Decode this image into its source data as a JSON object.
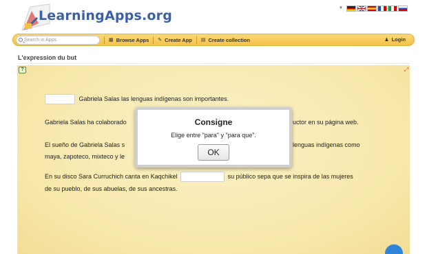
{
  "header": {
    "logo_text": "LearningApps.org",
    "languages": [
      "de",
      "en",
      "es",
      "fr",
      "it",
      "ru"
    ]
  },
  "nav": {
    "search_placeholder": "Search in Apps",
    "items": [
      {
        "label": "Browse Apps",
        "icon": "grid-icon"
      },
      {
        "label": "Create App",
        "icon": "pencil-icon"
      },
      {
        "label": "Create collection",
        "icon": "collection-icon"
      }
    ],
    "login_label": "Login"
  },
  "page": {
    "title": "L'expression du but"
  },
  "exercise": {
    "line1_text": "Gabriela Salas las lenguas indígenas son importantes.",
    "line2_left": "Gabriela Salas ha colaborado",
    "line2_right": "uctor en su página web.",
    "line3_left": "El sueño de Gabriela Salas s",
    "line3_right": "lenguas indígenas como",
    "line4_left": "maya, zapoteco, mixteco y le",
    "line5_left": "En su disco Sara Curruchich canta en Kaqchikel",
    "line5_right": "su público sepa que se inspira de las mujeres",
    "line6_text": "de su pueblo, de sus abuelas, de sus ancestras."
  },
  "modal": {
    "title": "Consigne",
    "text": "Elige entre \"para\" y \"para que\".",
    "ok_label": "OK"
  },
  "colors": {
    "brand_blue": "#3d5fa8",
    "nav_yellow": "#f5c247",
    "app_background": "#f7e7aa",
    "fab_blue": "#2f86d9"
  }
}
